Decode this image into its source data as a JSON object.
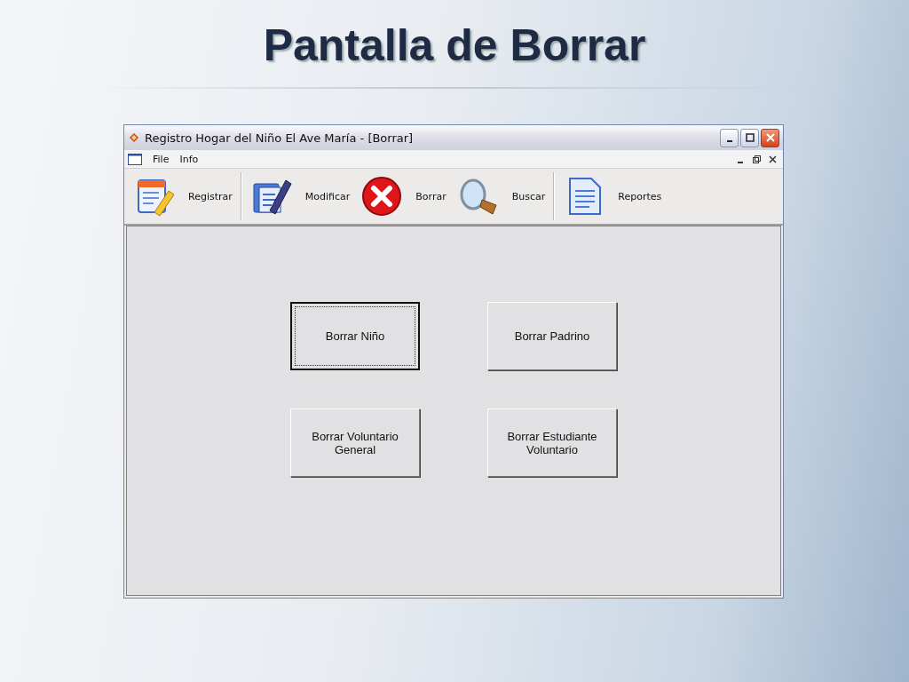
{
  "slide_title": "Pantalla de Borrar",
  "window": {
    "title": "Registro Hogar del Niño El Ave María - [Borrar]"
  },
  "menu": [
    "File",
    "Info"
  ],
  "toolbar": [
    [
      {
        "label": "Registrar"
      }
    ],
    [
      {
        "label": "Modificar"
      },
      {
        "label": "Borrar"
      },
      {
        "label": "Buscar"
      }
    ],
    [
      {
        "label": "Reportes"
      }
    ]
  ],
  "buttons": [
    {
      "label": "Borrar Niño",
      "focused": true
    },
    {
      "label": "Borrar Padrino",
      "focused": false
    },
    {
      "label": "Borrar Voluntario General",
      "focused": false
    },
    {
      "label": "Borrar Estudiante Voluntario",
      "focused": false
    }
  ]
}
